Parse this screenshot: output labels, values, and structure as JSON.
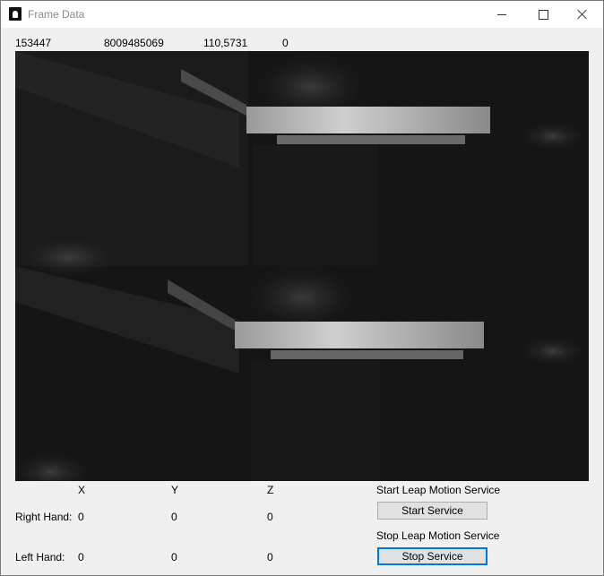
{
  "window": {
    "title": "Frame Data",
    "controls": [
      "minimize",
      "maximize",
      "close"
    ]
  },
  "frame_info": {
    "frame_id": "153447",
    "timestamp": "8009485069",
    "fps": "110,5731",
    "hands": "0"
  },
  "image_feed": {
    "description_icon": "camera-feed"
  },
  "coordinates": {
    "headers": {
      "x": "X",
      "y": "Y",
      "z": "Z"
    },
    "right_hand": {
      "label": "Right Hand:",
      "x": "0",
      "y": "0",
      "z": "0"
    },
    "left_hand": {
      "label": "Left Hand:",
      "x": "0",
      "y": "0",
      "z": "0"
    }
  },
  "service": {
    "start_label": "Start Leap Motion Service",
    "start_button": "Start Service",
    "stop_label": "Stop Leap Motion Service",
    "stop_button": "Stop Service"
  }
}
